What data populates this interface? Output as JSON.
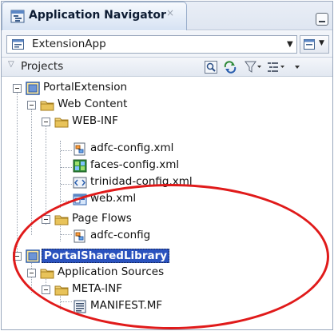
{
  "window": {
    "title": "Application Navigator",
    "close_glyph": "×"
  },
  "application": {
    "selected": "ExtensionApp"
  },
  "projects_section": {
    "label": "Projects"
  },
  "tree": [
    {
      "label": "PortalExtension",
      "icon": "project-icon",
      "level": 0
    },
    {
      "label": "Web Content",
      "icon": "folder-icon",
      "level": 1
    },
    {
      "label": "WEB-INF",
      "icon": "folder-icon",
      "level": 2
    },
    {
      "label": "adfc-config.xml",
      "icon": "adfc-config-file-icon",
      "level": 3
    },
    {
      "label": "faces-config.xml",
      "icon": "faces-config-file-icon",
      "level": 3
    },
    {
      "label": "trinidad-config.xml",
      "icon": "xml-file-icon",
      "level": 3
    },
    {
      "label": "web.xml",
      "icon": "web-xml-file-icon",
      "level": 3
    },
    {
      "label": "Page Flows",
      "icon": "folder-icon",
      "level": 2
    },
    {
      "label": "adfc-config",
      "icon": "adfc-config-file-icon",
      "level": 3
    },
    {
      "label": "PortalSharedLibrary",
      "icon": "project-icon",
      "level": 0,
      "selected": true
    },
    {
      "label": "Application Sources",
      "icon": "folder-icon",
      "level": 1
    },
    {
      "label": "META-INF",
      "icon": "folder-icon",
      "level": 2
    },
    {
      "label": "MANIFEST.MF",
      "icon": "text-file-icon",
      "level": 3
    }
  ],
  "colors": {
    "selection": "#2a52be",
    "highlight_ellipse": "#e01a1a",
    "folder": "#e8c35a"
  }
}
